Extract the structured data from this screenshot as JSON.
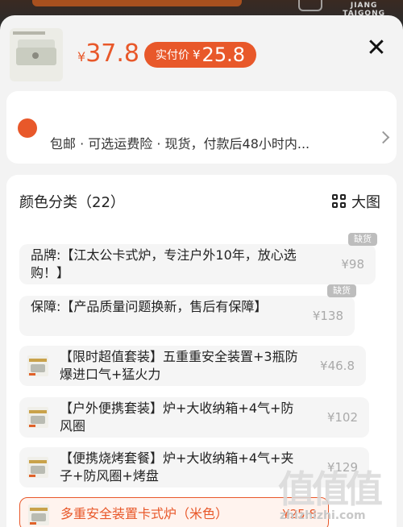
{
  "header": {
    "original_price": "37.8",
    "currency": "¥",
    "real_price_label": "实付价",
    "real_price": "25.8",
    "close_label": "✕"
  },
  "background": {
    "brand_line1": "JIANG",
    "brand_line2": "TAIGONG"
  },
  "shipping": {
    "title": "包邮  ·  可选运费险  ·  现货",
    "desc": "包邮 · 可选运费险 · 现货，付款后48小时内..."
  },
  "options_panel": {
    "title": "颜色分类（22）",
    "big_view_label": "大图",
    "items": [
      {
        "text": "品牌:【江太公卡式炉，专注户外10年，放心选购！】",
        "price": "¥98",
        "badge": "缺货",
        "has_image": false,
        "selected": false
      },
      {
        "text": "保障:【产品质量问题换新，售后有保障】",
        "price": "¥138",
        "badge": "缺货",
        "has_image": false,
        "selected": false
      },
      {
        "text": "【限时超值套装】五重重安全装置+3瓶防爆进口气+猛火力",
        "price": "¥46.8",
        "badge": "",
        "has_image": true,
        "selected": false
      },
      {
        "text": "【户外便携套装】炉+大收纳箱+4气+防风圈",
        "price": "¥102",
        "badge": "",
        "has_image": true,
        "selected": false
      },
      {
        "text": "【便携烧烤套餐】炉+大收纳箱+4气+夹子+防风圈+烤盘",
        "price": "¥129",
        "badge": "",
        "has_image": true,
        "selected": false
      },
      {
        "text": "多重安全装置卡式炉（米色）",
        "price": "¥25.8",
        "badge": "",
        "has_image": true,
        "selected": true
      }
    ]
  },
  "watermark": {
    "glyphs": "值值值",
    "url": "zhizhizhi.com"
  },
  "colors": {
    "accent": "#e8582a",
    "sheet_bg": "#f3f3f3",
    "option_bg": "#f5f5f5",
    "badge_bg": "#bdbdbd"
  },
  "icons": {
    "close": "close-icon",
    "grid": "grid-view-icon",
    "arrow": "chevron-right-icon",
    "shipping": "shipping-icon"
  }
}
